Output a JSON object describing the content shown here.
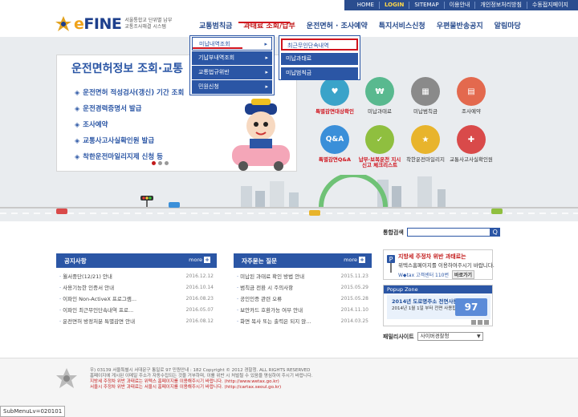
{
  "util_bar": [
    "HOME",
    "LOGIN",
    "SITEMAP",
    "이용안내",
    "개인정보처리방침",
    "수동접지페이지"
  ],
  "logo": {
    "brand_e": "e",
    "brand_rest": "FINE",
    "sub1": "서울통합교 단위별 납부",
    "sub2": "교통조사해결 시스템"
  },
  "gnb": [
    "교통범칙금",
    "과태료 조회/납부",
    "운전면허 · 조사예약",
    "특지서비스신청",
    "우편물반송공지",
    "알림마당"
  ],
  "dd1": [
    "미납내역조회",
    "기납부내역조회",
    "교통법규위반",
    "민원신청"
  ],
  "dd2": [
    "최근무인단속내역",
    "미납과태료",
    "미납범칙금"
  ],
  "banner": {
    "title": "운전면허정보 조회·교통",
    "items": [
      "운전면허 적성검사(갱신) 기간 조회",
      "운전경력증명서 발급",
      "조사예약",
      "교통사고사실확인원 발급",
      "착한운전마일리지제 신청 등"
    ]
  },
  "tiles": [
    {
      "label": "특별감면대상확인",
      "icon": "♥",
      "color": "#3aa3c9",
      "red": true
    },
    {
      "label": "미납과태료",
      "icon": "₩",
      "color": "#59b98f",
      "red": false
    },
    {
      "label": "미납범칙금",
      "icon": "▦",
      "color": "#8a8a8a",
      "red": false
    },
    {
      "label": "조사예약",
      "icon": "▤",
      "color": "#e3694e",
      "red": false
    },
    {
      "label": "특별감면Q&A",
      "icon": "Q&A",
      "color": "#3a8fd9",
      "red": true
    },
    {
      "label": "납부·보복운전 지시신고 체크리스트",
      "icon": "✓",
      "color": "#8fbf3f",
      "red": true
    },
    {
      "label": "착한운전마일리지",
      "icon": "★",
      "color": "#e8b42c",
      "red": false
    },
    {
      "label": "교통사고사실확인원",
      "icon": "✚",
      "color": "#d94a4a",
      "red": false
    }
  ],
  "search": {
    "label": "통합검색",
    "btn": "Q"
  },
  "notice": {
    "title": "공지사항",
    "more": "more",
    "rows": [
      {
        "t": "월서중단(12/21) 안내",
        "d": "2016.12.12"
      },
      {
        "t": "사용기능한 인증서 안내",
        "d": "2016.10.14"
      },
      {
        "t": "이파인 Non-ActiveX 프로그램...",
        "d": "2016.08.23"
      },
      {
        "t": "이파인 최근무인단속내역 프로...",
        "d": "2016.05.07"
      },
      {
        "t": "운전면허 방정처분 특별감면 안내",
        "d": "2016.08.12"
      }
    ]
  },
  "faq": {
    "title": "자주묻는 질문",
    "more": "more",
    "rows": [
      {
        "t": "미납된 과태료 확인 방법 안내",
        "d": "2015.11.23"
      },
      {
        "t": "범칙금 전환 시 주의사항",
        "d": "2015.05.29"
      },
      {
        "t": "공인인증 관련 오류",
        "d": "2015.05.28"
      },
      {
        "t": "보안카드 호환가능 여부 안내",
        "d": "2014.11.10"
      },
      {
        "t": "화면 복사 또는 출력은 되지 않...",
        "d": "2014.03.25"
      }
    ]
  },
  "ad": {
    "l1": "지방세 주정차 위반 과태료는",
    "l2": "위텍스홈페이지를 이용하여주시기 바랍니다.",
    "l3": "W◆tax 고객센터 110번",
    "btn": "바로가기"
  },
  "popup": {
    "head": "Popup Zone",
    "a": "2014년 도로명주소 전면사용",
    "b": "2014년 1월 1일 부터 전면 사용합니다",
    "c": "97"
  },
  "family": {
    "label": "패밀리사이트",
    "value": "사이버경찰청"
  },
  "footer": {
    "line1": "우) 03139 서울특별시 서대문구 통일로 97 민원안내 : 182    Copyright © 2012 경찰청. ALL RIGHTS RESERVED",
    "line2": "홈페이지에 게시된 이메일 주소가 자동수집되는 것을 거부하며, 이를 위반 시 처벌될 수 있음을 명심하여 주시기 바랍니다.",
    "line3": "지방세 주정차 위반 과태료는 위텍스 홈페이지를 이용해주시기 바랍니다. (http://www.wetax.go.kr)",
    "line4": "서울시 주정차 위반 과태료는 서울시 홈페이지를 이용해주시기 바랍니다. (http://cartax.seoul.go.kr)"
  },
  "status": "SubMenuLv=020101"
}
